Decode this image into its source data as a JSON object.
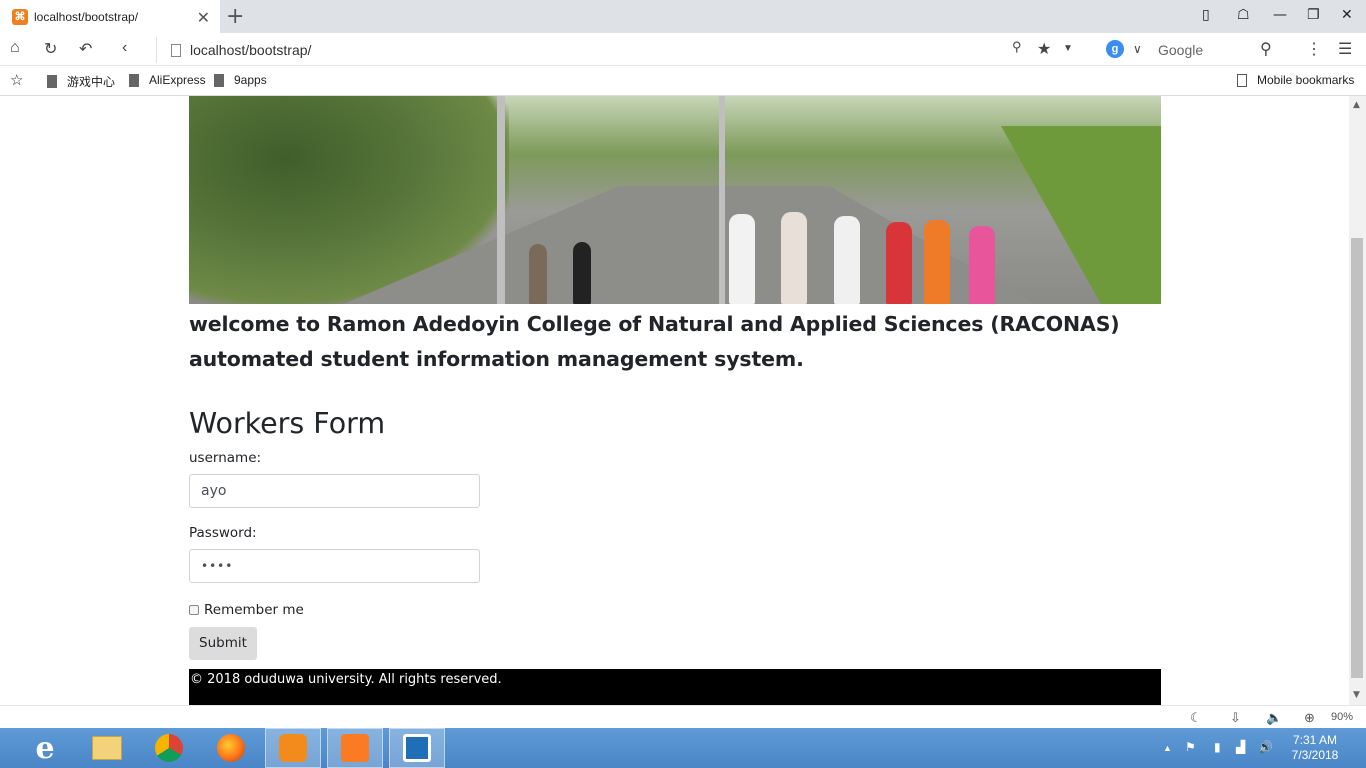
{
  "browser": {
    "tab_title": "localhost/bootstrap/",
    "url": "localhost/bootstrap/",
    "search_engine_label": "Google",
    "zoom": "90%",
    "bookmarks": [
      "游戏中心",
      "AliExpress",
      "9apps"
    ],
    "mobile_bookmarks": "Mobile bookmarks"
  },
  "page": {
    "welcome_text": "welcome to Ramon Adedoyin College of Natural and Applied Sciences (RACONAS) automated student information management system.",
    "form_title": "Workers Form",
    "username_label": "username:",
    "username_value": "ayo",
    "password_label": "Password:",
    "password_mask": "••••",
    "remember_label": "Remember me",
    "submit_label": "Submit",
    "footer_text": "© 2018 oduduwa university. All rights reserved."
  },
  "taskbar": {
    "time": "7:31 AM",
    "date": "7/3/2018"
  },
  "colors": {
    "tab_bar": "#dee1e6",
    "footer_bg": "#000000",
    "taskbar": "#4a86c7",
    "favicon": "#f07f1d"
  }
}
